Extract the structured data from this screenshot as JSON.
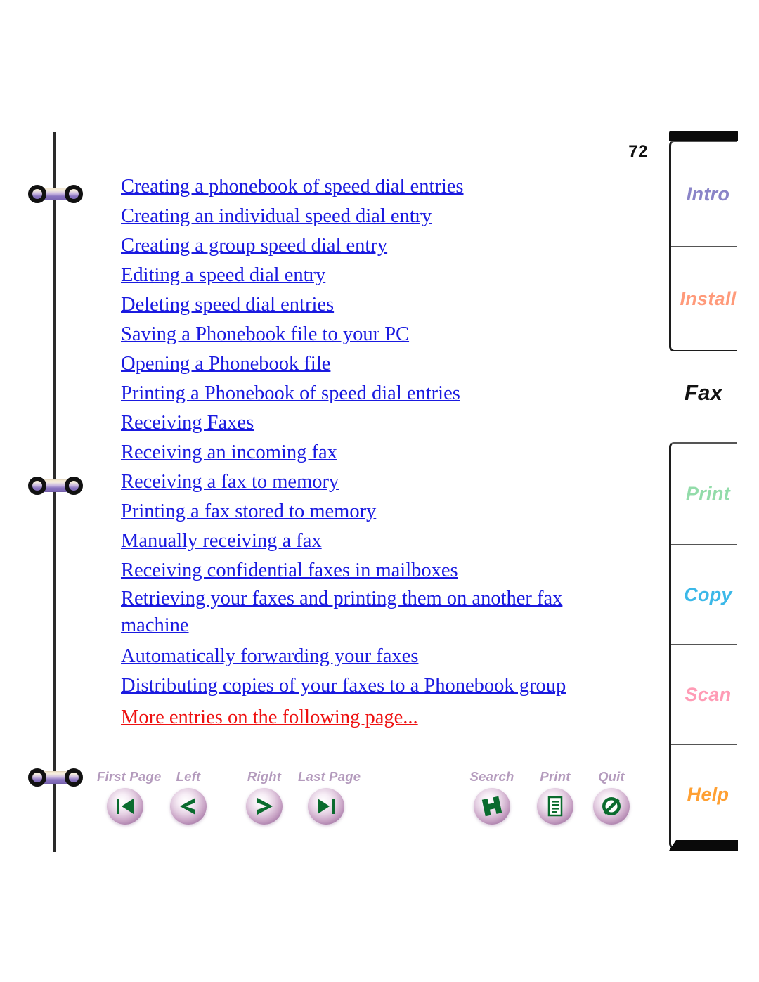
{
  "page": {
    "number": "72"
  },
  "toc": {
    "entries": [
      {
        "label": "Creating a phonebook of speed dial entries",
        "color": "blue",
        "wrap": false
      },
      {
        "label": "Creating an individual speed dial entry",
        "color": "blue",
        "wrap": false
      },
      {
        "label": "Creating a group speed dial entry",
        "color": "blue",
        "wrap": false
      },
      {
        "label": "Editing a speed dial entry",
        "color": "blue",
        "wrap": false
      },
      {
        "label": "Deleting speed dial entries",
        "color": "blue",
        "wrap": false
      },
      {
        "label": "Saving a Phonebook file to your PC",
        "color": "blue",
        "wrap": false
      },
      {
        "label": "Opening a Phonebook file",
        "color": "blue",
        "wrap": false
      },
      {
        "label": "Printing a Phonebook of speed dial entries",
        "color": "blue",
        "wrap": false
      },
      {
        "label": "Receiving Faxes",
        "color": "blue",
        "wrap": false
      },
      {
        "label": "Receiving an incoming fax",
        "color": "blue",
        "wrap": false
      },
      {
        "label": "Receiving a fax to memory",
        "color": "blue",
        "wrap": false
      },
      {
        "label": "Printing a fax stored to memory",
        "color": "blue",
        "wrap": false
      },
      {
        "label": "Manually receiving a fax",
        "color": "blue",
        "wrap": false
      },
      {
        "label": "Receiving confidential faxes in mailboxes",
        "color": "blue",
        "wrap": false
      },
      {
        "label": "Retrieving your faxes and printing them on another fax machine",
        "color": "blue",
        "wrap": true
      },
      {
        "label": "Automatically forwarding your faxes",
        "color": "blue",
        "wrap": false
      },
      {
        "label": "Distributing copies of your faxes to a Phonebook group",
        "color": "blue",
        "wrap": false
      },
      {
        "label": "More entries on the following page...",
        "color": "red",
        "wrap": false
      }
    ],
    "link_color": "#1a1ae0",
    "more_color": "#ee1111"
  },
  "toolbar": {
    "buttons": [
      {
        "label": "First Page",
        "icon": "first-page-icon"
      },
      {
        "label": "Left",
        "icon": "previous-page-icon"
      },
      {
        "label": "Right",
        "icon": "next-page-icon"
      },
      {
        "label": "Last Page",
        "icon": "last-page-icon"
      },
      {
        "label": "Search",
        "icon": "search-icon"
      },
      {
        "label": "Print",
        "icon": "print-icon"
      },
      {
        "label": "Quit",
        "icon": "quit-icon"
      }
    ],
    "label_color": "#b49bbd",
    "glyph_color": "#0a6b2e"
  },
  "tabstrip": {
    "groups": [
      {
        "tabs": [
          {
            "label": "Intro",
            "color": "#8a84c8"
          },
          {
            "label": "Install",
            "color": "#ff9a7a"
          }
        ]
      },
      {
        "tabs": [
          {
            "label": "Print",
            "color": "#93dcaa"
          },
          {
            "label": "Copy",
            "color": "#3bb8e8"
          },
          {
            "label": "Scan",
            "color": "#ff9bb5"
          },
          {
            "label": "Help",
            "color": "#ffa033"
          }
        ]
      }
    ],
    "active_tab": {
      "label": "Fax",
      "color": "#121212"
    }
  },
  "binder": {
    "rings": 3,
    "ring_bar_color": "#8a74c0"
  }
}
